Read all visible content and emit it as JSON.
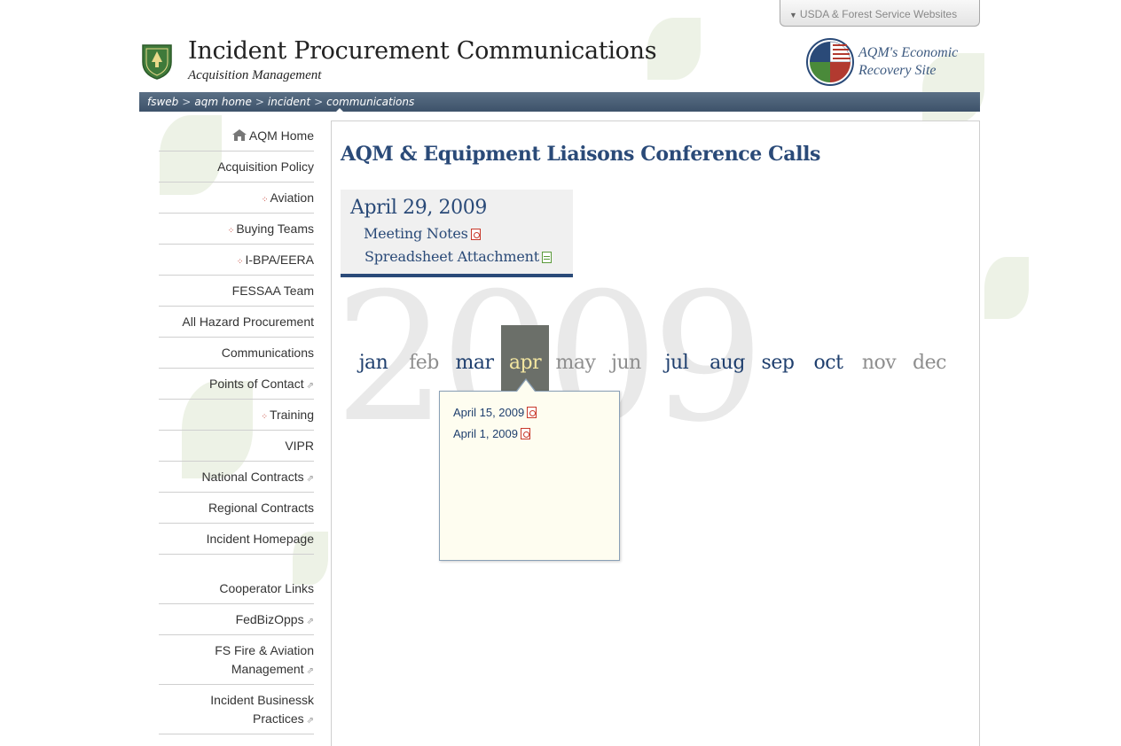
{
  "header": {
    "top_tab": "USDA & Forest Service Websites",
    "title": "Incident Procurement Communications",
    "subtitle": "Acquisition Management",
    "recovery_line1": "AQM's Economic",
    "recovery_line2": "Recovery Site"
  },
  "breadcrumb": [
    "fsweb",
    "aqm home",
    "incident",
    "communications"
  ],
  "breadcrumb_sep": ">",
  "sidenav": {
    "items": [
      {
        "label": "AQM Home",
        "icon": "home-icon"
      },
      {
        "label": "Acquisition Policy"
      },
      {
        "label": "Aviation",
        "icon": "expand-arrow-icon"
      },
      {
        "label": "Buying Teams",
        "icon": "expand-arrow-icon"
      },
      {
        "label": "I-BPA/EERA",
        "icon": "expand-arrow-icon"
      },
      {
        "label": "FESSAA Team"
      },
      {
        "label": "All Hazard Procurement"
      },
      {
        "label": "Communications"
      },
      {
        "label": "Points of Contact",
        "icon": "external-link-icon"
      },
      {
        "label": "Training",
        "icon": "expand-arrow-icon"
      },
      {
        "label": "VIPR"
      },
      {
        "label": "National Contracts",
        "icon": "external-link-icon"
      },
      {
        "label": "Regional Contracts"
      },
      {
        "label": "Incident Homepage"
      }
    ],
    "links": [
      {
        "label": "Cooperator Links"
      },
      {
        "label": "FedBizOpps",
        "icon": "external-link-icon"
      },
      {
        "label_line1": "FS Fire & Aviation",
        "label_line2": "Management",
        "icon": "external-link-icon"
      },
      {
        "label_line1": "Incident Businessk",
        "label_line2": "Practices",
        "icon": "external-link-icon"
      }
    ]
  },
  "main": {
    "heading": "AQM & Equipment Liaisons Conference Calls",
    "latest": {
      "date": "April 29, 2009",
      "links": [
        {
          "label": "Meeting Notes",
          "icon": "pdf-icon"
        },
        {
          "label": "Spreadsheet Attachment",
          "icon": "spreadsheet-icon"
        }
      ]
    },
    "year": "2009",
    "months": [
      {
        "label": "jan",
        "state": "has"
      },
      {
        "label": "feb",
        "state": "none"
      },
      {
        "label": "mar",
        "state": "has"
      },
      {
        "label": "apr",
        "state": "active"
      },
      {
        "label": "may",
        "state": "none"
      },
      {
        "label": "jun",
        "state": "none"
      },
      {
        "label": "jul",
        "state": "has"
      },
      {
        "label": "aug",
        "state": "has"
      },
      {
        "label": "sep",
        "state": "has"
      },
      {
        "label": "oct",
        "state": "has"
      },
      {
        "label": "nov",
        "state": "none"
      },
      {
        "label": "dec",
        "state": "none"
      }
    ],
    "popup_links": [
      {
        "label": "April 15, 2009",
        "icon": "pdf-icon"
      },
      {
        "label": "April 1, 2009",
        "icon": "pdf-icon"
      }
    ]
  },
  "colors": {
    "brand_blue": "#2a4a78",
    "active_month_bg": "#6b6f69",
    "active_month_text": "#f3e6a0",
    "popup_bg": "#fefdf0"
  }
}
